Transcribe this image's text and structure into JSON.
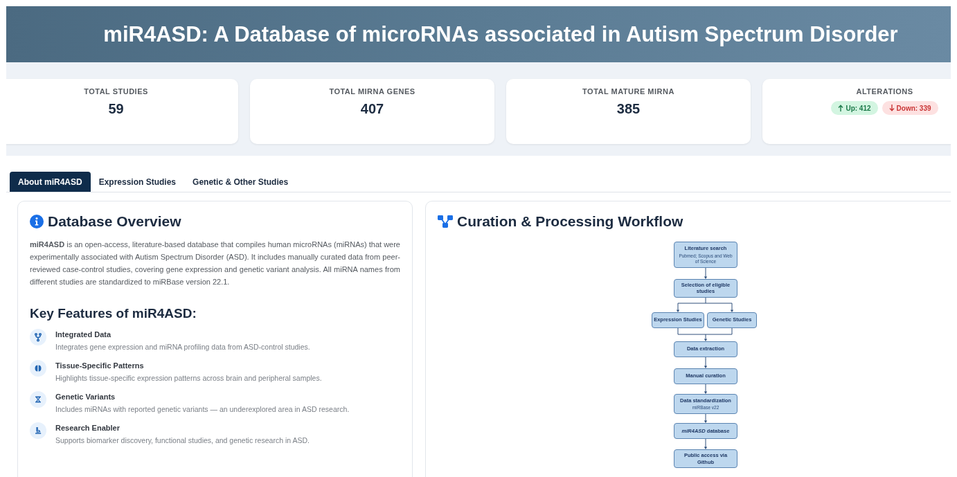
{
  "header": {
    "title": "miR4ASD: A Database of microRNAs associated in Autism Spectrum Disorder"
  },
  "stats": [
    {
      "kind": "count",
      "label": "TOTAL STUDIES",
      "value": "59"
    },
    {
      "kind": "count",
      "label": "TOTAL MIRNA GENES",
      "value": "407"
    },
    {
      "kind": "count",
      "label": "TOTAL MATURE MIRNA",
      "value": "385"
    },
    {
      "kind": "badges",
      "label": "ALTERATIONS",
      "badges": [
        {
          "kind": "up",
          "text": "Up: 412"
        },
        {
          "kind": "down",
          "text": "Down: 339"
        }
      ]
    }
  ],
  "tabs": [
    {
      "label": "About miR4ASD",
      "selected": true
    },
    {
      "label": "Expression Studies",
      "selected": false
    },
    {
      "label": "Genetic & Other Studies",
      "selected": false
    }
  ],
  "overview": {
    "title": "Database Overview",
    "text": "**miR4ASD** is an open-access, literature-based database that compiles human microRNAs (miRNAs) that were experimentally associated with Autism Spectrum Disorder (ASD). It includes manually curated data from peer-reviewed case-control studies, covering gene expression and genetic variant analysis. All miRNA names from different studies are standardized to miRBase version 22.1.",
    "features_title": "Key Features of miR4ASD:",
    "features": [
      {
        "title": "Integrated Data",
        "description": "Integrates gene expression and miRNA profiling data from ASD-control studies."
      },
      {
        "title": "Tissue-Specific Patterns",
        "description": "Highlights tissue-specific expression patterns across brain and peripheral samples."
      },
      {
        "title": "Genetic Variants",
        "description": "Includes miRNAs with reported genetic variants — an underexplored area in ASD research."
      },
      {
        "title": "Research Enabler",
        "description": "Supports biomarker discovery, functional studies, and genetic research in ASD."
      }
    ]
  },
  "workflow": {
    "title": "Curation & Processing Workflow",
    "steps": [
      {
        "kind": "step",
        "label": "Literature search",
        "note": "Pubmed; Scopus and Web of Science"
      },
      {
        "kind": "step",
        "label": "Selection of eligible studies"
      },
      {
        "kind": "branch",
        "branches": [
          {
            "label": "Expression Studies"
          },
          {
            "label": "Genetic Studies"
          }
        ]
      },
      {
        "kind": "step",
        "label": "Data extraction"
      },
      {
        "kind": "step",
        "label": "Manual curation"
      },
      {
        "kind": "step",
        "label": "Data standardization",
        "note": "miRBase v22"
      },
      {
        "kind": "step",
        "label": "*miR4ASD* database"
      },
      {
        "kind": "step",
        "label": "Public access via Github"
      }
    ]
  }
}
